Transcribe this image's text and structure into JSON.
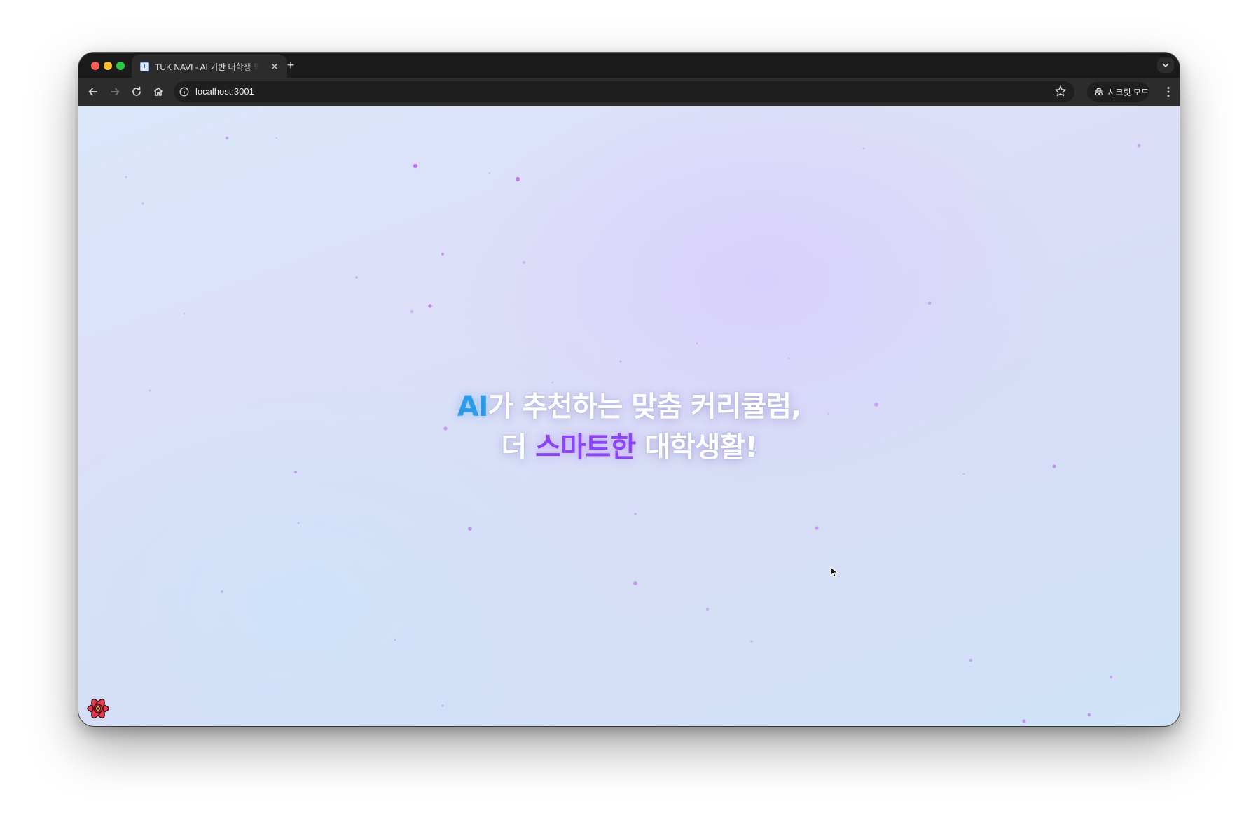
{
  "browser": {
    "tab_title": "TUK NAVI - AI 기반 대학생 학습",
    "tab_favicon_text": "T",
    "url": "localhost:3001",
    "incognito_label": "시크릿 모드"
  },
  "hero": {
    "line1_highlight": "AI",
    "line1_rest": "가 추천하는 맞춤 커리큘럼,",
    "line2_prefix": "더 ",
    "line2_highlight": "스마트한",
    "line2_suffix": " 대학생활!"
  },
  "colors": {
    "ai_highlight": "#2e9be8",
    "smart_highlight": "#8b45f5",
    "particle": "#b35ce8",
    "page_background": "#dbe2f8"
  },
  "icons": {
    "favicon": "tuk-navi-favicon-icon",
    "back": "arrow-left-icon",
    "forward": "arrow-right-icon",
    "reload": "reload-icon",
    "home": "home-icon",
    "site_info": "info-circle-icon",
    "bookmark": "star-icon",
    "incognito": "incognito-icon",
    "menu": "kebab-menu-icon",
    "dev_badge": "react-atom-icon"
  }
}
